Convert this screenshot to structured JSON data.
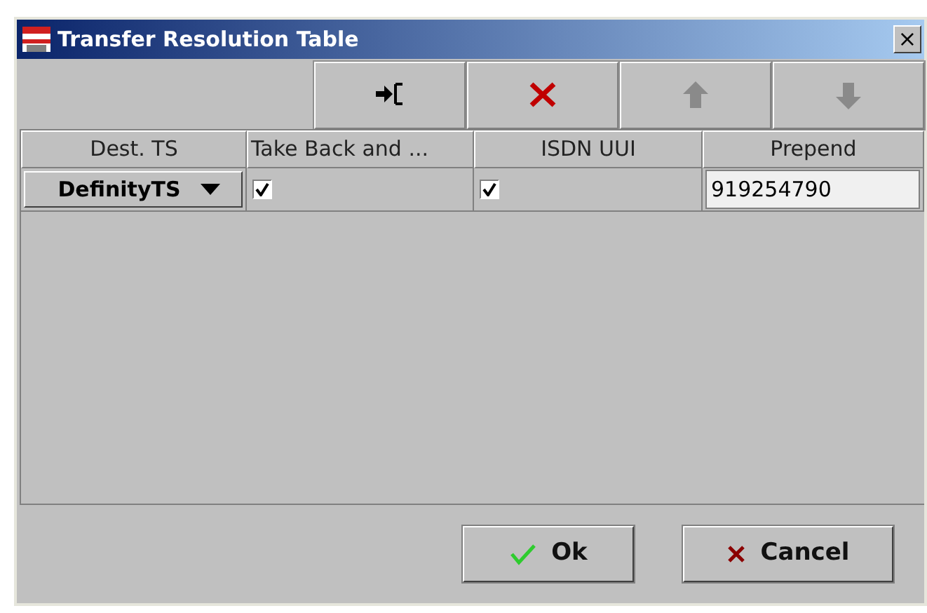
{
  "window": {
    "title": "Transfer Resolution Table",
    "close": "×"
  },
  "toolbar": [
    {
      "kind": "insert",
      "disabled": false
    },
    {
      "kind": "delete",
      "disabled": false
    },
    {
      "kind": "up",
      "disabled": true
    },
    {
      "kind": "down",
      "disabled": true
    }
  ],
  "table": {
    "columns": [
      "Dest. TS",
      "Take Back and ...",
      "ISDN UUI",
      "Prepend"
    ],
    "rows": [
      {
        "dest_ts": "DefinityTS",
        "take_back": true,
        "isdn_uui": true,
        "prepend": "919254790"
      }
    ]
  },
  "buttons": [
    {
      "kind": "ok",
      "label": "Ok"
    },
    {
      "kind": "cancel",
      "label": "Cancel"
    }
  ]
}
